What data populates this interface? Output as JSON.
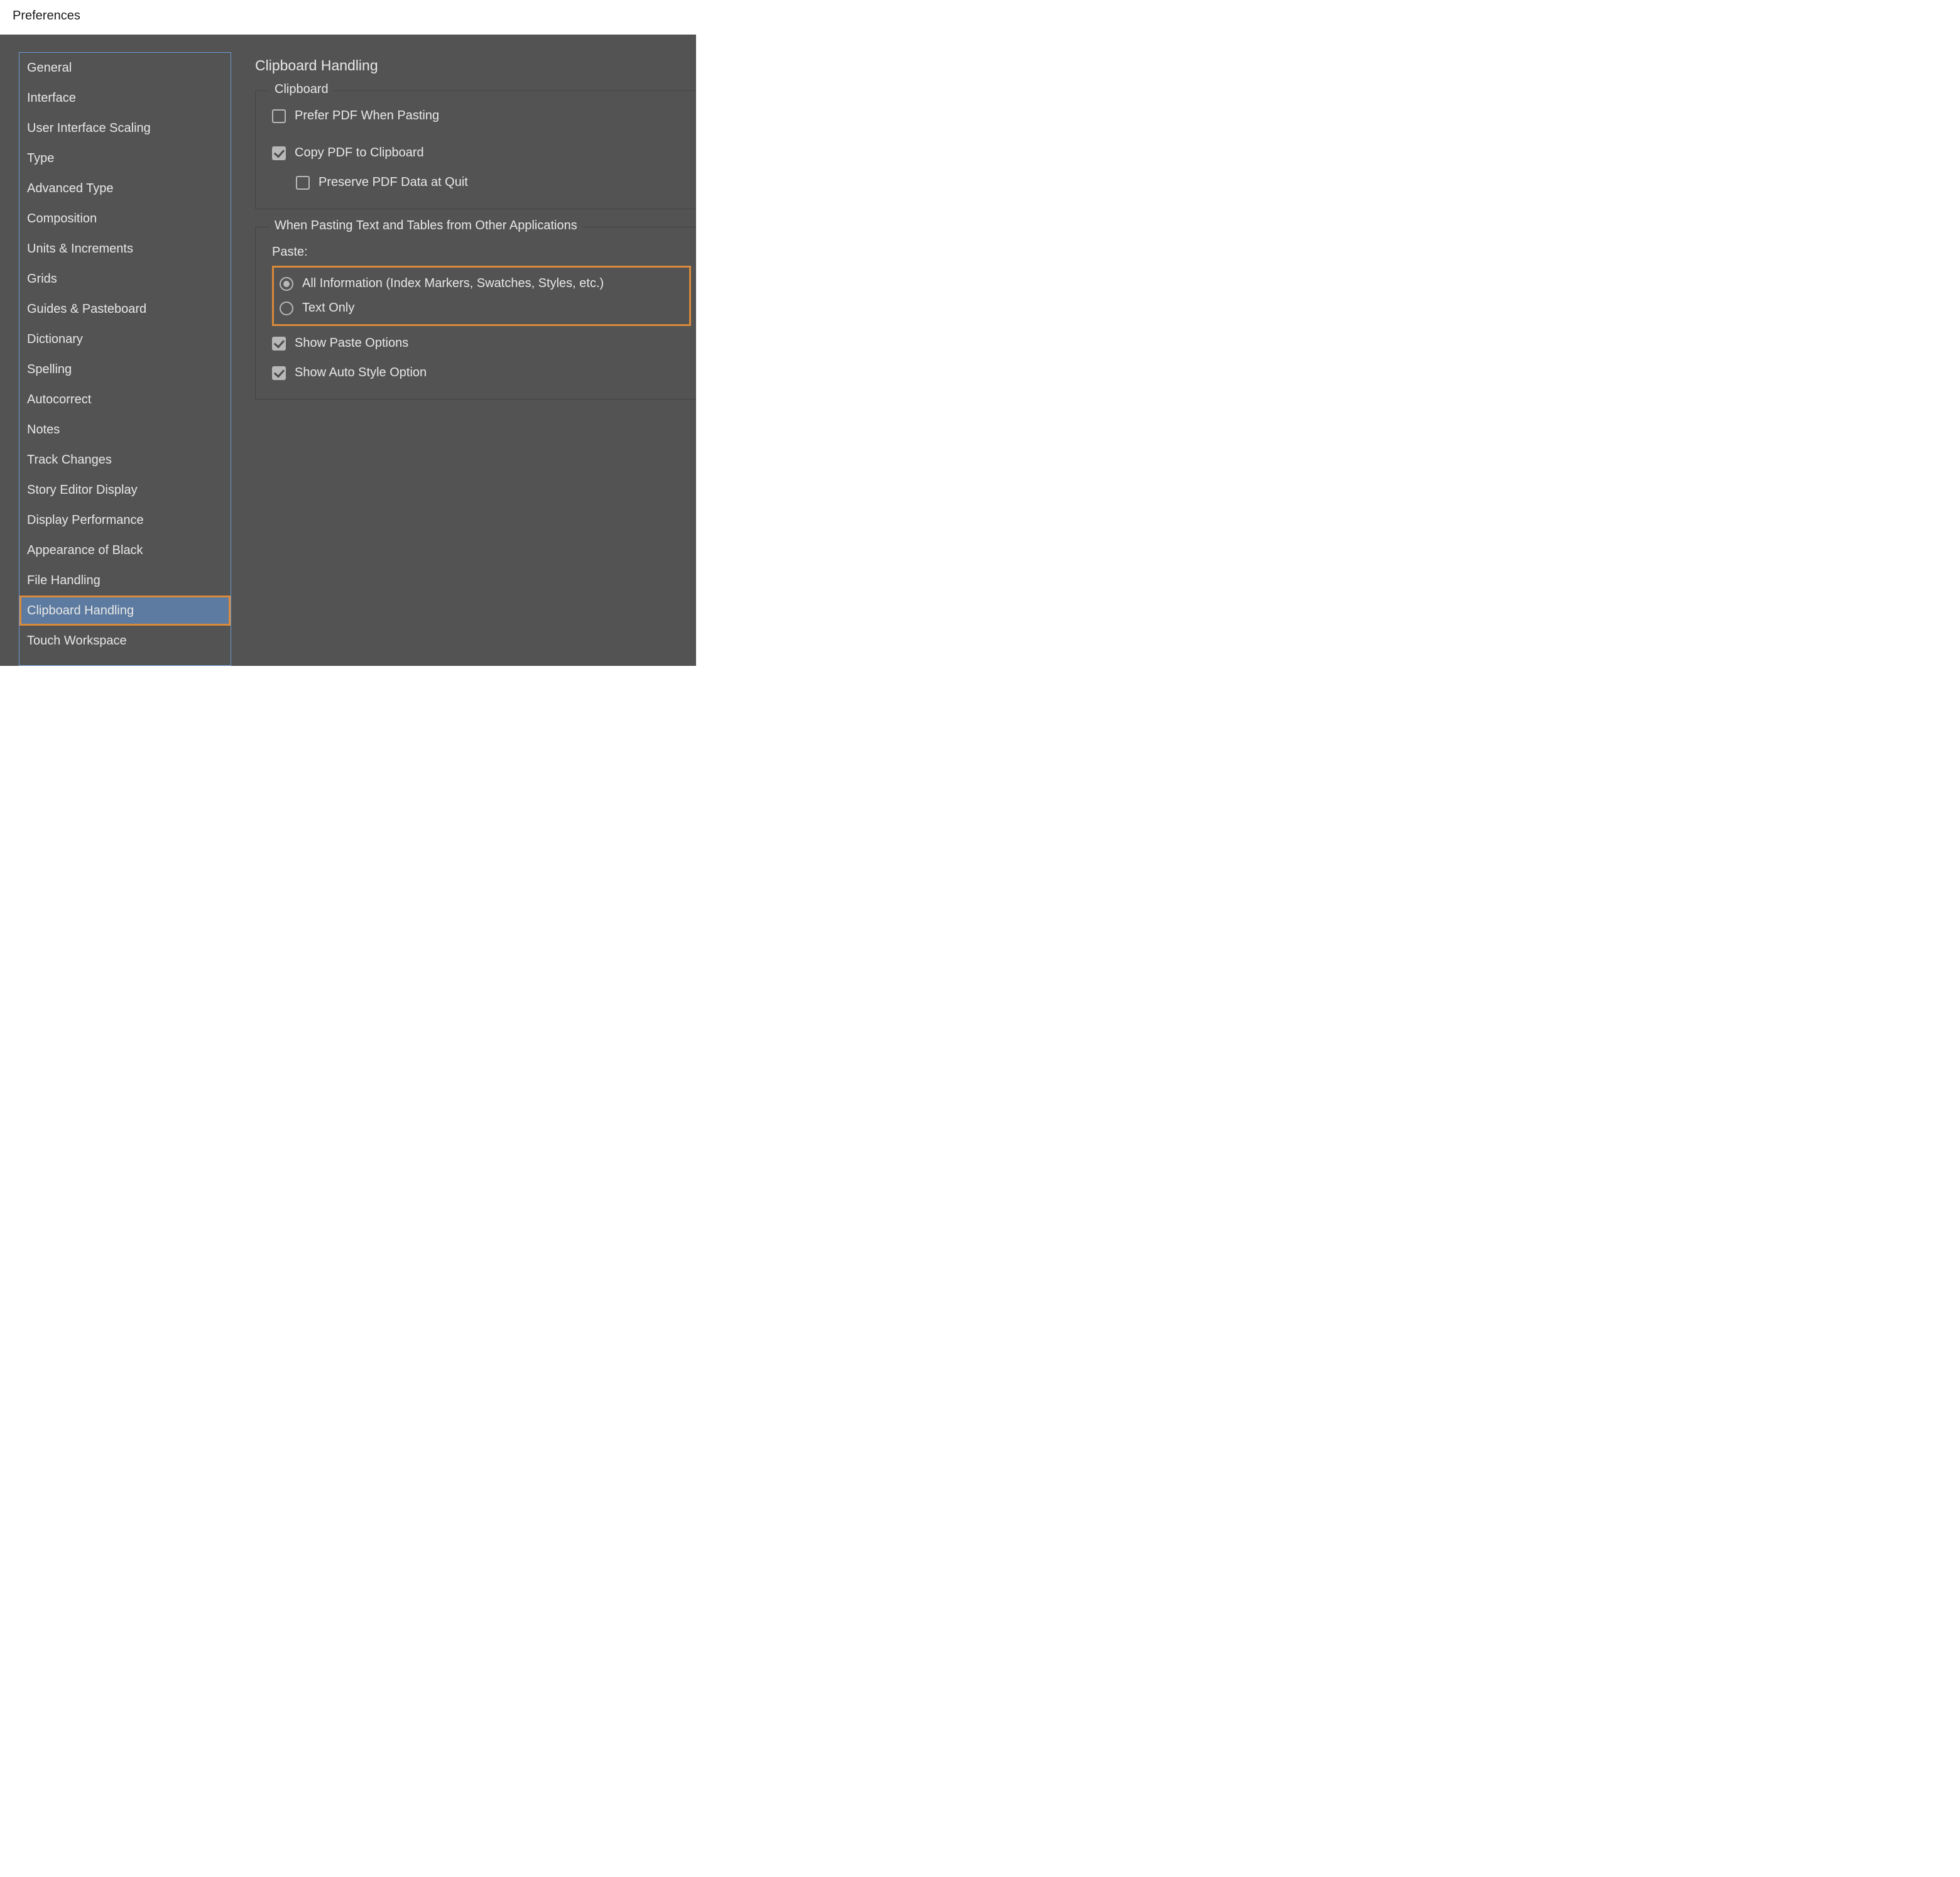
{
  "window": {
    "title": "Preferences"
  },
  "sidebar": {
    "items": [
      {
        "label": "General",
        "selected": false
      },
      {
        "label": "Interface",
        "selected": false
      },
      {
        "label": "User Interface Scaling",
        "selected": false
      },
      {
        "label": "Type",
        "selected": false
      },
      {
        "label": "Advanced Type",
        "selected": false
      },
      {
        "label": "Composition",
        "selected": false
      },
      {
        "label": "Units & Increments",
        "selected": false
      },
      {
        "label": "Grids",
        "selected": false
      },
      {
        "label": "Guides & Pasteboard",
        "selected": false
      },
      {
        "label": "Dictionary",
        "selected": false
      },
      {
        "label": "Spelling",
        "selected": false
      },
      {
        "label": "Autocorrect",
        "selected": false
      },
      {
        "label": "Notes",
        "selected": false
      },
      {
        "label": "Track Changes",
        "selected": false
      },
      {
        "label": "Story Editor Display",
        "selected": false
      },
      {
        "label": "Display Performance",
        "selected": false
      },
      {
        "label": "Appearance of Black",
        "selected": false
      },
      {
        "label": "File Handling",
        "selected": false
      },
      {
        "label": "Clipboard Handling",
        "selected": true
      },
      {
        "label": "Touch Workspace",
        "selected": false
      }
    ]
  },
  "content": {
    "title": "Clipboard Handling",
    "clipboard_group": {
      "legend": "Clipboard",
      "prefer_pdf": {
        "label": "Prefer PDF When Pasting",
        "checked": false
      },
      "copy_pdf": {
        "label": "Copy PDF to Clipboard",
        "checked": true
      },
      "preserve_pdf": {
        "label": "Preserve PDF Data at Quit",
        "checked": false
      }
    },
    "paste_group": {
      "legend": "When Pasting Text and Tables from Other Applications",
      "paste_label": "Paste:",
      "all_info": {
        "label": "All Information (Index Markers, Swatches, Styles, etc.)",
        "checked": true
      },
      "text_only": {
        "label": "Text Only",
        "checked": false
      },
      "show_paste_options": {
        "label": "Show Paste Options",
        "checked": true
      },
      "show_auto_style": {
        "label": "Show Auto Style Option",
        "checked": true
      }
    }
  },
  "colors": {
    "highlight": "#d98a3a",
    "panel_bg": "#535353",
    "selected_bg": "#5d7ba0"
  }
}
